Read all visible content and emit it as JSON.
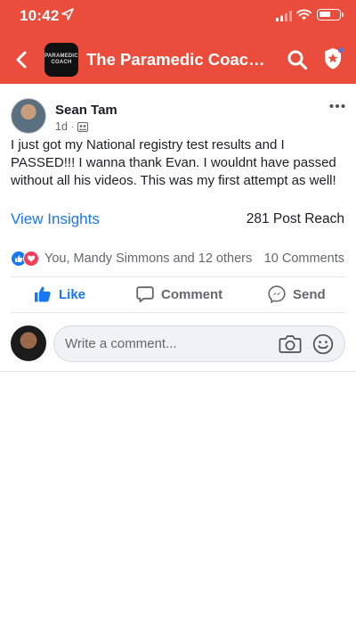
{
  "status_bar": {
    "time": "10:42"
  },
  "header": {
    "group_title": "The Paramedic Coach I...",
    "group_avatar_text": [
      "PARAMEDIC",
      "COACH"
    ],
    "accent_color": "#ea4d3c"
  },
  "post": {
    "author": "Sean Tam",
    "timestamp": "1d",
    "meta_separator": "·",
    "text": "I just got my National registry test results and I PASSED!!! I wanna thank Evan. I wouldnt have passed without all his videos. This was my first attempt as well!",
    "insights_label": "View Insights",
    "reach": "281 Post Reach",
    "reactions_text": "You, Mandy Simmons and 12 others",
    "comments_count": "10 Comments"
  },
  "actions": {
    "like": "Like",
    "comment": "Comment",
    "send": "Send"
  },
  "comment_box": {
    "placeholder": "Write a comment..."
  },
  "icons": {
    "location": "location-arrow-icon",
    "signal": "cellular-signal-icon",
    "wifi": "wifi-icon",
    "battery": "battery-icon",
    "back": "chevron-left-icon",
    "search": "search-icon",
    "badge": "admin-badge-icon",
    "more": "more-horizontal-icon",
    "group": "group-audience-icon",
    "like_reaction": "thumbs-up-reaction-icon",
    "love_reaction": "heart-reaction-icon",
    "like_action": "thumbs-up-icon",
    "comment_action": "comment-bubble-icon",
    "send_action": "messenger-icon",
    "camera": "camera-icon",
    "emoji": "emoji-icon"
  }
}
